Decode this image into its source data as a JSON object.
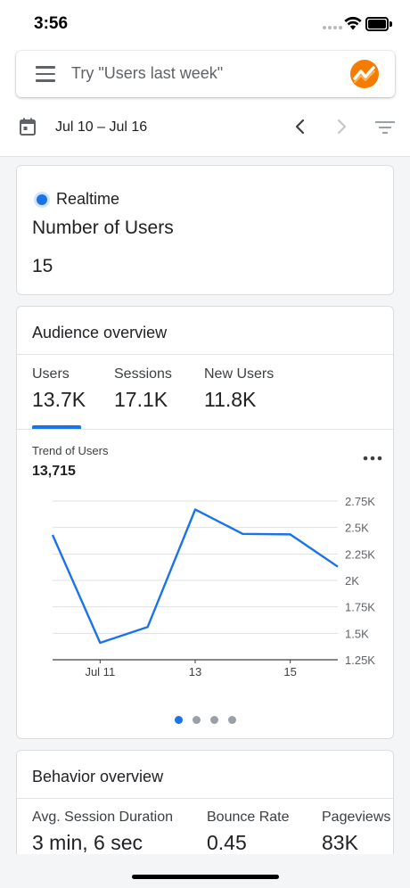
{
  "status_bar": {
    "time": "3:56"
  },
  "search": {
    "placeholder": "Try \"Users last week\""
  },
  "toolbar": {
    "date_range": "Jul 10 – Jul 16",
    "icons": [
      "menu-icon",
      "analytics-logo",
      "calendar-icon",
      "chevron-left-icon",
      "chevron-right-icon",
      "filter-icon"
    ]
  },
  "realtime": {
    "label": "Realtime",
    "metric": "Number of Users",
    "value": "15"
  },
  "audience": {
    "title": "Audience overview",
    "tabs": [
      {
        "label": "Users",
        "value": "13.7K"
      },
      {
        "label": "Sessions",
        "value": "17.1K"
      },
      {
        "label": "New Users",
        "value": "11.8K"
      }
    ],
    "trend_label": "Trend of Users",
    "trend_value": "13,715"
  },
  "behavior": {
    "title": "Behavior overview",
    "metrics": [
      {
        "label": "Avg. Session Duration",
        "value": "3 min, 6 sec"
      },
      {
        "label": "Bounce Rate",
        "value": "0.45"
      },
      {
        "label": "Pageviews",
        "value": "83K"
      }
    ]
  },
  "colors": {
    "accent": "#1a73e8",
    "logo_orange": "#f57c00"
  },
  "chart_data": {
    "type": "line",
    "x": [
      "Jul 10",
      "Jul 11",
      "Jul 12",
      "Jul 13",
      "Jul 14",
      "Jul 15",
      "Jul 16"
    ],
    "x_ticks": [
      "Jul 11",
      "13",
      "15"
    ],
    "y_ticks": [
      "2.75K",
      "2.5K",
      "2.25K",
      "2K",
      "1.75K",
      "1.5K",
      "1.25K"
    ],
    "series": [
      {
        "values": [
          2430,
          1410,
          1560,
          2670,
          2440,
          2435,
          2130
        ]
      }
    ],
    "ylim": [
      1250,
      2750
    ],
    "grid": true
  }
}
